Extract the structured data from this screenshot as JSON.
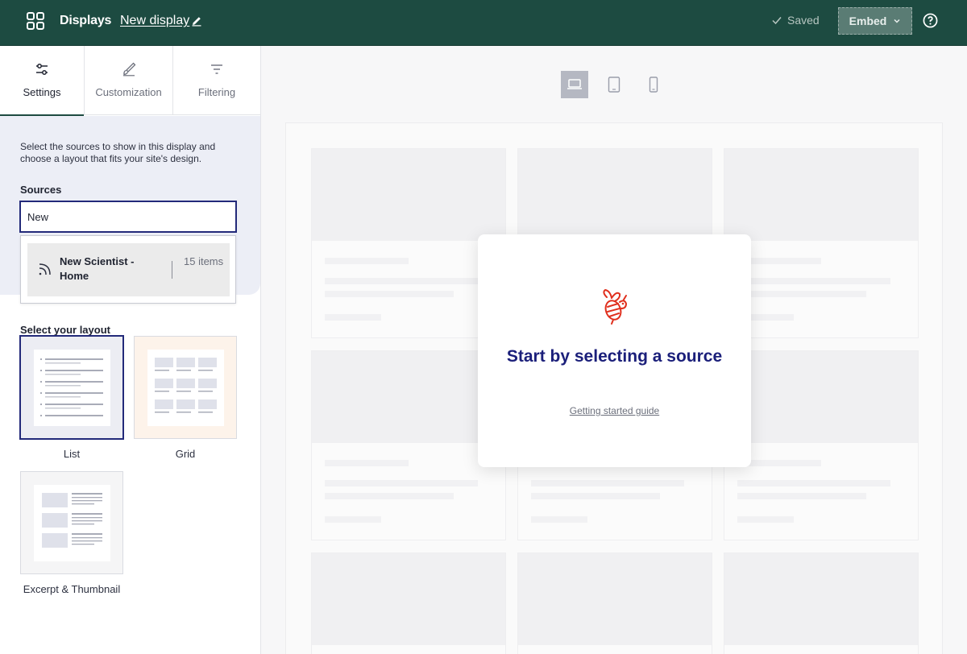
{
  "header": {
    "app_name": "Displays",
    "display_name": "New display",
    "saved_label": "Saved",
    "embed_label": "Embed"
  },
  "tabs": [
    {
      "label": "Settings",
      "active": true,
      "icon": "sliders-icon"
    },
    {
      "label": "Customization",
      "active": false,
      "icon": "brush-icon"
    },
    {
      "label": "Filtering",
      "active": false,
      "icon": "filter-icon"
    }
  ],
  "settings": {
    "intro": "Select the sources to show in this display and choose a layout that fits your site's design.",
    "sources_label": "Sources",
    "sources_value": "New",
    "dropdown": {
      "title": "New Scientist - Home",
      "count": "15 items",
      "icon": "rss-icon"
    },
    "layout_label": "Select your layout",
    "layouts": [
      {
        "label": "List",
        "selected": true
      },
      {
        "label": "Grid",
        "selected": false
      },
      {
        "label": "Excerpt & Thumbnail",
        "selected": false
      }
    ]
  },
  "preview": {
    "devices": [
      {
        "name": "desktop",
        "active": true
      },
      {
        "name": "tablet",
        "active": false
      },
      {
        "name": "mobile",
        "active": false
      }
    ],
    "empty_title": "Start by selecting a source",
    "guide_link": "Getting started guide"
  },
  "colors": {
    "header_bg": "#1d4b41",
    "accent": "#232a7a",
    "title": "#1b1f7a",
    "bee": "#e0301e"
  }
}
